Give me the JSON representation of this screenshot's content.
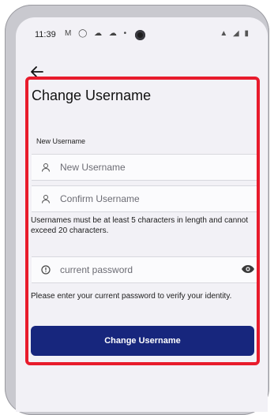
{
  "status_bar": {
    "time": "11:39",
    "left_icons": "M ◯ ☁ ☁ •",
    "right_icons": "▲ ◢ ▮"
  },
  "header": {
    "back_icon": "arrow-left-icon"
  },
  "form": {
    "title": "Change Username",
    "section_label": "New Username",
    "new_username_placeholder": "New Username",
    "confirm_username_placeholder": "Confirm Username",
    "username_rules": "Usernames must be at least 5 characters in length and cannot exceed 20 characters.",
    "password_placeholder": "current password",
    "password_hint": "Please enter your current password to verify your identity.",
    "submit_label": "Change Username"
  },
  "colors": {
    "accent_border": "#e81b2c",
    "button": "#17267d"
  }
}
